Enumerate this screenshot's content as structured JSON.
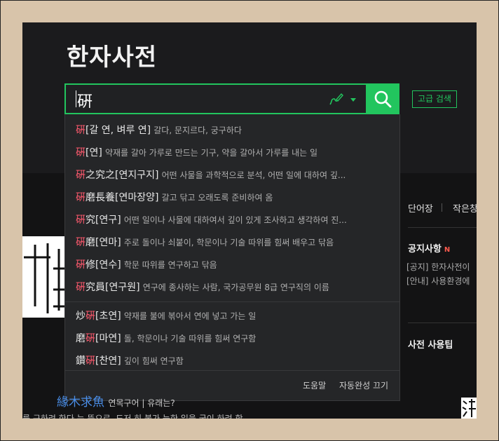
{
  "header": {
    "title": "한자사전"
  },
  "search": {
    "value": "硏",
    "handwriting_icon": "handwriting-pen-icon",
    "search_icon": "magnifier-icon",
    "advanced_label": "고급 검색"
  },
  "autocomplete": {
    "items": [
      {
        "pre": "",
        "hl": "硏",
        "post": "[갈 연, 벼루 연]",
        "def": "갈다, 문지르다, 궁구하다"
      },
      {
        "pre": "",
        "hl": "硏",
        "post": "[연]",
        "def": "약재를 갈아 가루로 만드는 기구, 약을 갈아서 가루를 내는 일"
      },
      {
        "pre": "",
        "hl": "硏",
        "post": "之究之[연지구지]",
        "def": "어떤 사물을 과학적으로 분석, 어떤 일에 대하여 깊..."
      },
      {
        "pre": "",
        "hl": "硏",
        "post": "磨長養[연마장양]",
        "def": "갈고 닦고 오래도록 준비하여 옴"
      },
      {
        "pre": "",
        "hl": "硏",
        "post": "究[연구]",
        "def": "어떤 일이나 사물에 대하여서 깊이 있게 조사하고 생각하여 진..."
      },
      {
        "pre": "",
        "hl": "硏",
        "post": "磨[연마]",
        "def": "주로 돌이나 쇠붙이, 학문이나 기술 따위를 힘써 배우고 닦음"
      },
      {
        "pre": "",
        "hl": "硏",
        "post": "修[연수]",
        "def": "학문 따위를 연구하고 닦음"
      },
      {
        "pre": "",
        "hl": "硏",
        "post": "究員[연구원]",
        "def": "연구에 종사하는 사람, 국가공무원 8급 연구직의 이름"
      },
      {
        "pre": "炒",
        "hl": "硏",
        "post": "[초연]",
        "def": "약재를 불에 볶아서 연에 넣고 가는 일"
      },
      {
        "pre": "磨",
        "hl": "硏",
        "post": "[마연]",
        "def": "돌, 학문이나 기술 따위를 힘써 연구함"
      },
      {
        "pre": "鑽",
        "hl": "硏",
        "post": "[찬연]",
        "def": "깊이 힘써 연구함"
      }
    ],
    "help_label": "도움말",
    "autocomplete_off_label": "자동완성 끄기"
  },
  "sidebar": {
    "tab_wordbook": "단어장",
    "tab_small": "작은창",
    "notice_title": "공지사항",
    "notice_new": "N",
    "notice_lines": [
      "[공지] 한자사전이",
      "[안내] 사용환경에"
    ],
    "tips_title": "사전 사용팁"
  },
  "background": {
    "link_text": "緣木求魚",
    "link_after": "연목구어 | 유래는?",
    "body_text": "를 구하려 한다 는 뜻으로, 도저 히 불가 능한 일을 굳이 하려 함"
  },
  "colors": {
    "accent": "#22c55e",
    "highlight": "#ff5a6e",
    "background": "#1b1b1d"
  }
}
